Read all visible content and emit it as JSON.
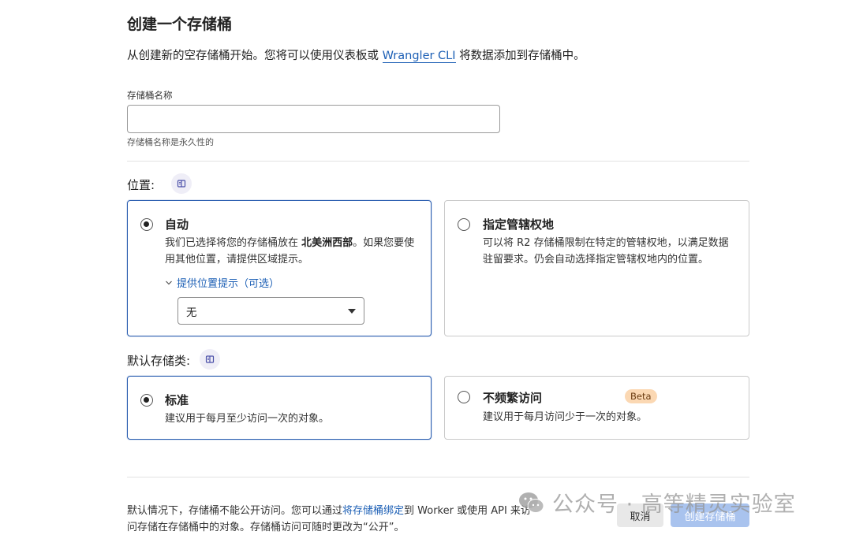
{
  "page": {
    "title": "创建一个存储桶",
    "intro_before": "从创建新的空存储桶开始。您将可以使用仪表板或 ",
    "intro_link": "Wrangler CLI",
    "intro_after": " 将数据添加到存储桶中。"
  },
  "bucket_name": {
    "label": "存储桶名称",
    "value": "",
    "placeholder": "",
    "help": "存储桶名称是永久性的"
  },
  "location": {
    "label": "位置:",
    "info_icon": "book-icon",
    "options": [
      {
        "title": "自动",
        "desc_before": "我们已选择将您的存储桶放在 ",
        "desc_bold": "北美洲西部",
        "desc_after": "。如果您要使用其他位置，请提供区域提示。",
        "selected": true,
        "hint_toggle": "提供位置提示（可选）",
        "hint_value": "无"
      },
      {
        "title": "指定管辖权地",
        "desc": "可以将 R2 存储桶限制在特定的管辖权地，以满足数据驻留要求。仍会自动选择指定管辖权地内的位置。",
        "selected": false
      }
    ]
  },
  "storage_class": {
    "label": "默认存储类:",
    "info_icon": "book-icon",
    "options": [
      {
        "title": "标准",
        "desc": "建议用于每月至少访问一次的对象。",
        "selected": true
      },
      {
        "title": "不频繁访问",
        "badge": "Beta",
        "desc": "建议用于每月访问少于一次的对象。",
        "selected": false
      }
    ]
  },
  "footer": {
    "note_before": "默认情况下，存储桶不能公开访问。您可以通过",
    "note_link": "将存储桶绑定",
    "note_after": "到 Worker 或使用 API 来访问存储在存储桶中的对象。存储桶访问可随时更改为“公开”。",
    "cancel_label": "取消",
    "create_label": "创建存储桶"
  },
  "watermark": {
    "text": "公众号 · 高等精灵实验室",
    "icon": "wechat-icon"
  },
  "colors": {
    "accent": "#1c5fb5",
    "selected_border": "#2a5db0",
    "beta_badge": "#fbd8b3",
    "create_button": "#a9c3ee"
  }
}
